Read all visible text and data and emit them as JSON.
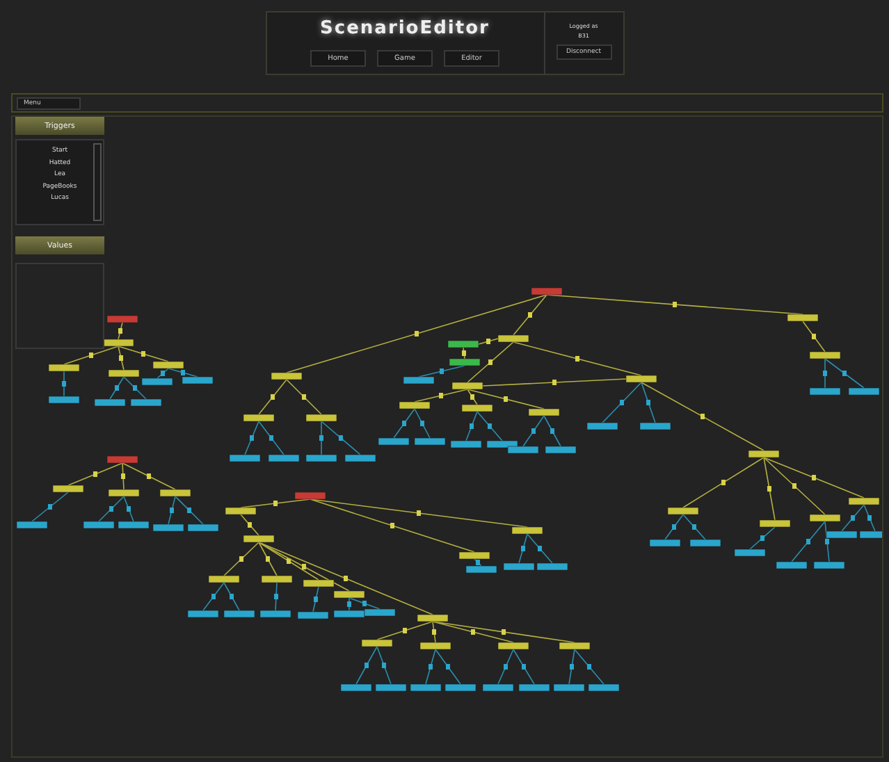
{
  "header": {
    "title": "ScenarioEditor",
    "nav": [
      "Home",
      "Game",
      "Editor"
    ],
    "login": [
      "Logged as",
      "B31"
    ],
    "disconnect": "Disconnect"
  },
  "toolbar": {
    "menu": "Menu"
  },
  "triggers": {
    "title": "Triggers",
    "items": [
      "Start",
      "Hatted",
      "Lea",
      "PageBooks",
      "Lucas"
    ]
  },
  "values": {
    "title": "Values"
  }
}
